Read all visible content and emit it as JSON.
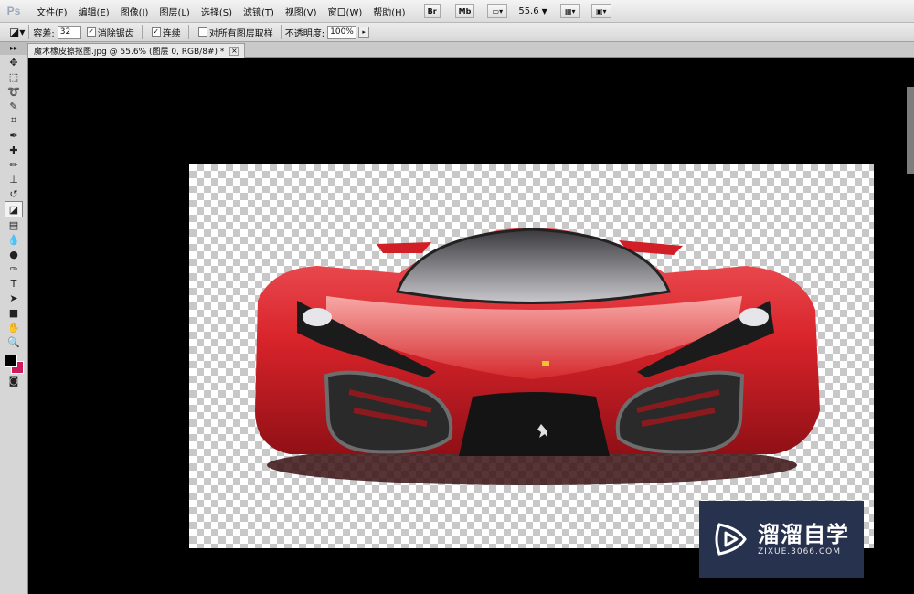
{
  "app": {
    "logo": "Ps"
  },
  "menu": [
    "文件(F)",
    "编辑(E)",
    "图像(I)",
    "图层(L)",
    "选择(S)",
    "滤镜(T)",
    "视图(V)",
    "窗口(W)",
    "帮助(H)"
  ],
  "app_bar": {
    "btn_br": "Br",
    "btn_mb": "Mb",
    "zoom": "55.6"
  },
  "options": {
    "tolerance_label": "容差:",
    "tolerance_value": "32",
    "antialias_label": "消除锯齿",
    "contiguous_label": "连续",
    "sample_all_label": "对所有图层取样",
    "opacity_label": "不透明度:",
    "opacity_value": "100%"
  },
  "document": {
    "tab_title": "魔术橡皮擦抠图.jpg @ 55.6% (图层 0, RGB/8#) *"
  },
  "tools": [
    {
      "name": "move-tool-icon",
      "glyph": "✥"
    },
    {
      "name": "marquee-tool-icon",
      "glyph": "⬚"
    },
    {
      "name": "lasso-tool-icon",
      "glyph": "➰"
    },
    {
      "name": "quick-select-tool-icon",
      "glyph": "✎"
    },
    {
      "name": "crop-tool-icon",
      "glyph": "⌗"
    },
    {
      "name": "eyedropper-tool-icon",
      "glyph": "✒"
    },
    {
      "name": "healing-brush-tool-icon",
      "glyph": "✚"
    },
    {
      "name": "brush-tool-icon",
      "glyph": "✏"
    },
    {
      "name": "clone-stamp-tool-icon",
      "glyph": "⊥"
    },
    {
      "name": "history-brush-tool-icon",
      "glyph": "↺"
    },
    {
      "name": "magic-eraser-tool-icon",
      "glyph": "◪"
    },
    {
      "name": "gradient-tool-icon",
      "glyph": "▤"
    },
    {
      "name": "blur-tool-icon",
      "glyph": "💧"
    },
    {
      "name": "dodge-tool-icon",
      "glyph": "●"
    },
    {
      "name": "pen-tool-icon",
      "glyph": "✑"
    },
    {
      "name": "type-tool-icon",
      "glyph": "T"
    },
    {
      "name": "path-select-tool-icon",
      "glyph": "➤"
    },
    {
      "name": "shape-tool-icon",
      "glyph": "■"
    },
    {
      "name": "hand-tool-icon",
      "glyph": "✋"
    },
    {
      "name": "zoom-tool-icon",
      "glyph": "🔍"
    }
  ],
  "colors": {
    "foreground": "#000000",
    "background": "#d01c5e",
    "car_red": "#d8232a"
  },
  "watermark": {
    "name": "溜溜自学",
    "url": "ZIXUE.3066.COM"
  }
}
